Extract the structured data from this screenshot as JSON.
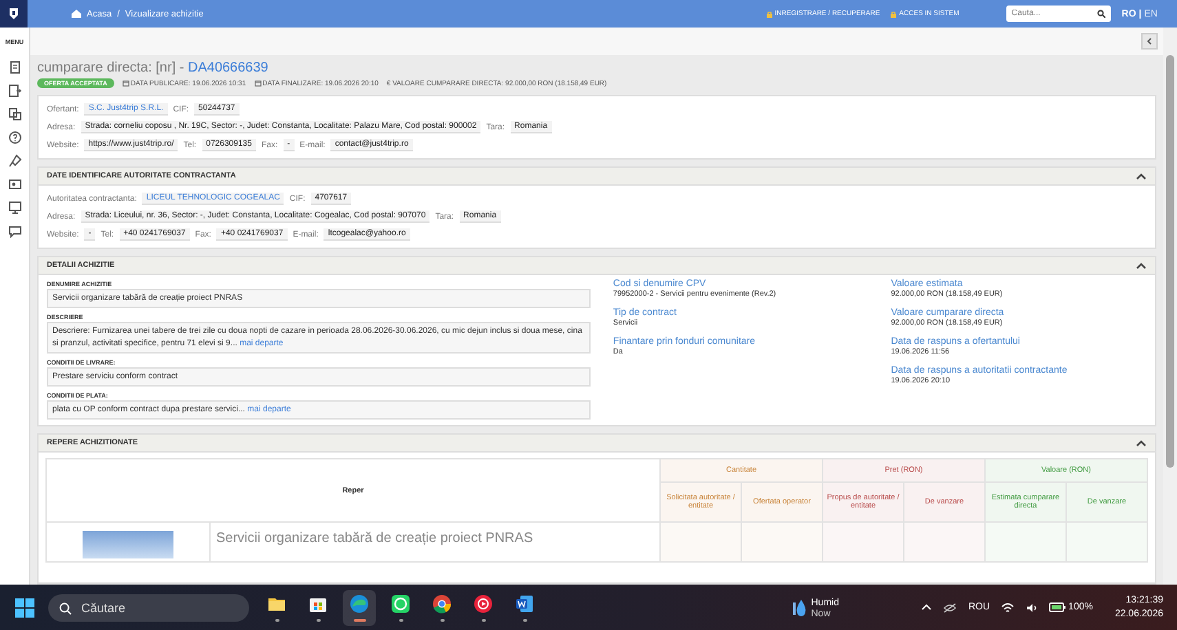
{
  "topbar": {
    "breadcrumb": [
      "Acasa",
      "Vizualizare achizitie"
    ],
    "breadcrumb_separator": "/",
    "links": [
      "INREGISTRARE / RECUPERARE",
      "ACCES IN SISTEM"
    ],
    "search": {
      "placeholder": "Cauta..."
    },
    "languages": [
      {
        "label": "RO",
        "selected": true
      },
      {
        "label": "EN",
        "selected": false
      }
    ],
    "language_separator": "|"
  },
  "sidebar": {
    "menu_label": "MENU"
  },
  "header": {
    "title": "cumparare directa: [nr] - ",
    "code": "DA40666639",
    "status": "OFERTA ACCEPTATA",
    "meta": [
      {
        "kind": "date",
        "text": "DATA PUBLICARE: 19.06.2026 10:31"
      },
      {
        "kind": "date",
        "text": "DATA FINALIZARE: 19.06.2026 20:10"
      },
      {
        "kind": "money",
        "text": "€ VALOARE CUMPARARE DIRECTA: 92.000,00  RON (18.158,49  EUR)"
      }
    ]
  },
  "offerer": {
    "name": {
      "label": "Ofertant:",
      "value": "S.C. Just4trip S.R.L."
    },
    "cif": {
      "label": "CIF:",
      "value": "50244737"
    },
    "address": {
      "label": "Adresa:",
      "value": "Strada: corneliu coposu , Nr. 19C, Sector: -, Judet: Constanta, Localitate: Palazu Mare, Cod postal: 900002"
    },
    "country": {
      "label": "Tara:",
      "value": "Romania"
    },
    "website": {
      "label": "Website:",
      "value": "https://www.just4trip.ro/"
    },
    "phone": {
      "label": "Tel:",
      "value": "0726309135"
    },
    "fax": {
      "label": "Fax:",
      "value": "-"
    },
    "email": {
      "label": "E-mail:",
      "value": "contact@just4trip.ro"
    }
  },
  "authority": {
    "title": "DATE IDENTIFICARE AUTORITATE CONTRACTANTA",
    "expanded": true,
    "name": {
      "label": "Autoritatea contractanta:",
      "value": "LICEUL TEHNOLOGIC COGEALAC"
    },
    "cif": {
      "label": "CIF:",
      "value": "4707617"
    },
    "address": {
      "label": "Adresa:",
      "value": "Strada: Liceului, nr. 36, Sector: -, Judet: Constanta, Localitate: Cogealac, Cod postal: 907070"
    },
    "country": {
      "label": "Tara:",
      "value": "Romania"
    },
    "website": {
      "label": "Website:",
      "value": "-"
    },
    "phone": {
      "label": "Tel:",
      "value": "+40 0241769037"
    },
    "fax": {
      "label": "Fax:",
      "value": "+40 0241769037"
    },
    "email": {
      "label": "E-mail:",
      "value": "ltcogealac@yahoo.ro"
    }
  },
  "details": {
    "title": "DETALII ACHIZITIE",
    "expanded": true,
    "fields": [
      {
        "label": "DENUMIRE ACHIZITIE",
        "value": "Servicii organizare tabără de creație proiect PNRAS"
      },
      {
        "label": "DESCRIERE",
        "value": "Descriere: Furnizarea unei tabere de trei zile cu doua nopti de cazare in perioada 28.06.2026-30.06.2026, cu mic dejun inclus si doua mese, cina si pranzul, activitati specifice, pentru 71 elevi si 9...",
        "more": "mai departe"
      },
      {
        "label": "CONDITII DE LIVRARE:",
        "value": "Prestare serviciu conform contract"
      },
      {
        "label": "CONDITII DE PLATA:",
        "value": "plata cu OP conform contract dupa prestare servici...",
        "more": "mai departe"
      }
    ],
    "columns": [
      [
        {
          "label": "Cod si denumire CPV",
          "value": "79952000-2 - Servicii pentru evenimente (Rev.2)"
        },
        {
          "label": "Tip de contract",
          "value": "Servicii"
        },
        {
          "label": "Finantare prin fonduri comunitare",
          "value": "Da"
        }
      ],
      [
        {
          "label": "Valoare estimata",
          "value": "92.000,00  RON (18.158,49  EUR)"
        },
        {
          "label": "Valoare cumparare directa",
          "value": "92.000,00  RON (18.158,49  EUR)"
        },
        {
          "label": "Data de raspuns a ofertantului",
          "value": "19.06.2026 11:56"
        },
        {
          "label": "Data de raspuns a autoritatii contractante",
          "value": "19.06.2026 20:10"
        }
      ]
    ]
  },
  "items": {
    "title": "REPERE ACHIZITIONATE",
    "expanded": true,
    "reper_header": "Reper",
    "groups": [
      {
        "label": "Cantitate",
        "color": "#c8843a",
        "columns": [
          "Solicitata autoritate / entitate",
          "Ofertata operator"
        ]
      },
      {
        "label": "Pret (RON)",
        "color": "#b84a4a",
        "columns": [
          "Propus de autoritate / entitate",
          "De vanzare"
        ]
      },
      {
        "label": "Valoare (RON)",
        "color": "#3f9a3f",
        "columns": [
          "Estimata cumparare directa",
          "De vanzare"
        ]
      }
    ],
    "rows": [
      {
        "name": "Servicii organizare tabără de creație proiect PNRAS"
      }
    ]
  },
  "taskbar": {
    "search": {
      "placeholder": "Căutare"
    },
    "apps": [
      {
        "kind": "files",
        "selected": false
      },
      {
        "kind": "store",
        "selected": false
      },
      {
        "kind": "edge",
        "selected": true
      },
      {
        "kind": "whatsapp",
        "selected": false
      },
      {
        "kind": "chrome",
        "selected": false
      },
      {
        "kind": "music",
        "selected": false
      },
      {
        "kind": "word",
        "selected": false
      }
    ],
    "weather": {
      "title": "Humid",
      "subtitle": "Now"
    },
    "language": "ROU",
    "battery": "100%",
    "time": "13:21:39",
    "date": "22.06.2026"
  }
}
